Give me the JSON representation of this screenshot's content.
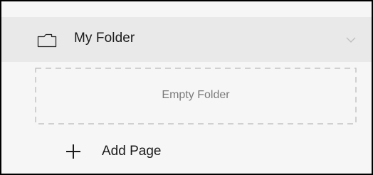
{
  "folder": {
    "name": "My Folder",
    "icon": "folder-icon",
    "toggle_icon": "chevron-down-icon",
    "expanded": true,
    "empty_text": "Empty Folder"
  },
  "actions": {
    "add_page_label": "Add Page",
    "add_icon": "plus-icon"
  },
  "colors": {
    "header_background": "#e9e9e9",
    "panel_background": "#f6f6f6",
    "dashed_border": "#c4c4c4",
    "muted_text": "#7a7a7a",
    "primary_text": "#1a1a1a"
  }
}
